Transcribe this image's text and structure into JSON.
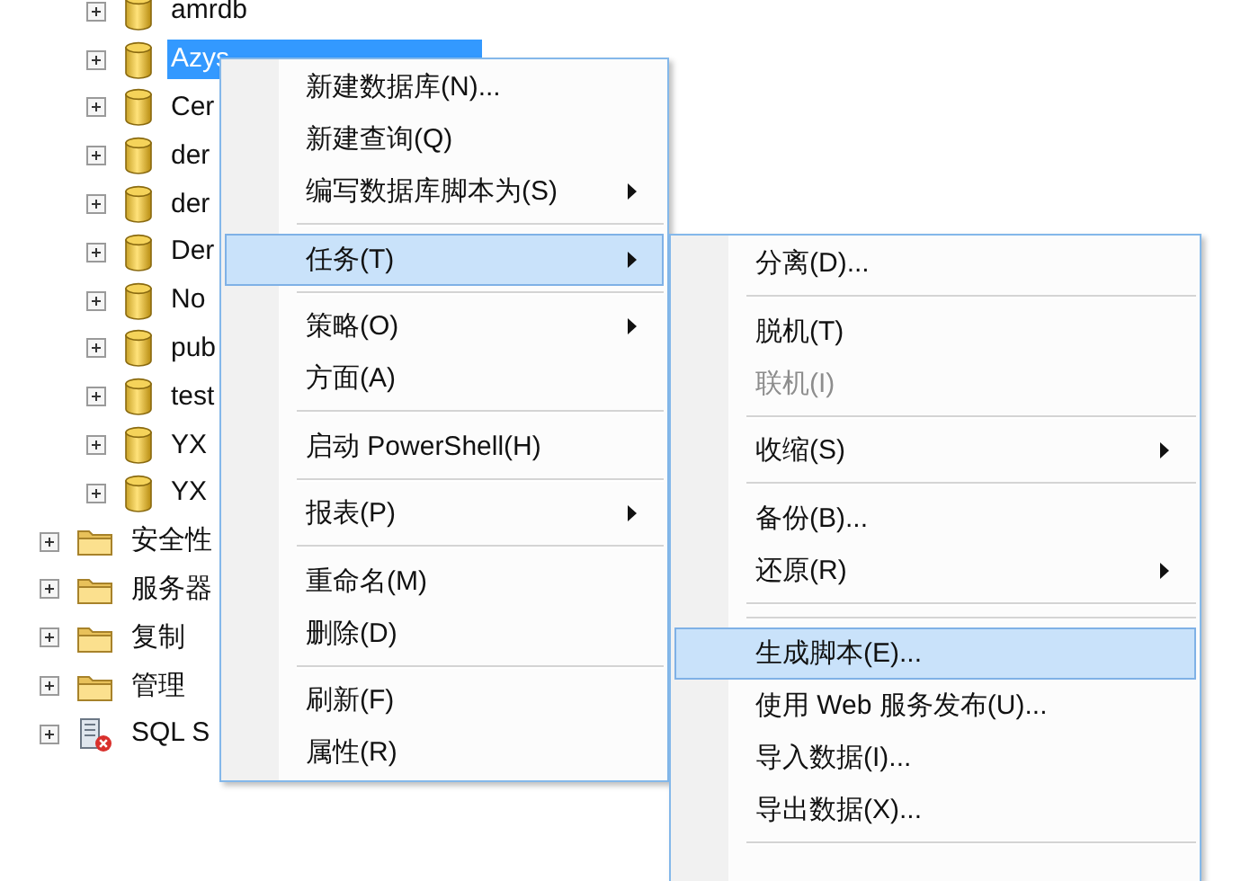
{
  "tree": {
    "databases": [
      {
        "label": "amrdb",
        "selected": false
      },
      {
        "label": "Azys",
        "selected": true
      },
      {
        "label": "Cer",
        "selected": false
      },
      {
        "label": "der",
        "selected": false
      },
      {
        "label": "der",
        "selected": false
      },
      {
        "label": "Der",
        "selected": false
      },
      {
        "label": "No",
        "selected": false
      },
      {
        "label": "pub",
        "selected": false
      },
      {
        "label": "test",
        "selected": false
      },
      {
        "label": "YX",
        "selected": false
      },
      {
        "label": "YX",
        "selected": false
      }
    ],
    "nodes": [
      {
        "label": "安全性",
        "kind": "folder"
      },
      {
        "label": "服务器",
        "kind": "folder"
      },
      {
        "label": "复制",
        "kind": "folder"
      },
      {
        "label": "管理",
        "kind": "folder"
      },
      {
        "label": "SQL S",
        "kind": "agent"
      }
    ]
  },
  "context_menu": {
    "items": [
      {
        "kind": "item",
        "label": "新建数据库(N)...",
        "submenu": false,
        "selected": false,
        "disabled": false
      },
      {
        "kind": "item",
        "label": "新建查询(Q)",
        "submenu": false,
        "selected": false,
        "disabled": false
      },
      {
        "kind": "item",
        "label": "编写数据库脚本为(S)",
        "submenu": true,
        "selected": false,
        "disabled": false
      },
      {
        "kind": "separator"
      },
      {
        "kind": "item",
        "label": "任务(T)",
        "submenu": true,
        "selected": true,
        "disabled": false
      },
      {
        "kind": "separator"
      },
      {
        "kind": "item",
        "label": "策略(O)",
        "submenu": true,
        "selected": false,
        "disabled": false
      },
      {
        "kind": "item",
        "label": "方面(A)",
        "submenu": false,
        "selected": false,
        "disabled": false
      },
      {
        "kind": "separator"
      },
      {
        "kind": "item",
        "label": "启动 PowerShell(H)",
        "submenu": false,
        "selected": false,
        "disabled": false
      },
      {
        "kind": "separator"
      },
      {
        "kind": "item",
        "label": "报表(P)",
        "submenu": true,
        "selected": false,
        "disabled": false
      },
      {
        "kind": "separator"
      },
      {
        "kind": "item",
        "label": "重命名(M)",
        "submenu": false,
        "selected": false,
        "disabled": false
      },
      {
        "kind": "item",
        "label": "删除(D)",
        "submenu": false,
        "selected": false,
        "disabled": false
      },
      {
        "kind": "separator"
      },
      {
        "kind": "item",
        "label": "刷新(F)",
        "submenu": false,
        "selected": false,
        "disabled": false
      },
      {
        "kind": "item",
        "label": "属性(R)",
        "submenu": false,
        "selected": false,
        "disabled": false
      }
    ]
  },
  "tasks_submenu": {
    "items": [
      {
        "kind": "item",
        "label": "分离(D)...",
        "submenu": false,
        "selected": false,
        "disabled": false
      },
      {
        "kind": "separator"
      },
      {
        "kind": "item",
        "label": "脱机(T)",
        "submenu": false,
        "selected": false,
        "disabled": false
      },
      {
        "kind": "item",
        "label": "联机(I)",
        "submenu": false,
        "selected": false,
        "disabled": true
      },
      {
        "kind": "separator"
      },
      {
        "kind": "item",
        "label": "收缩(S)",
        "submenu": true,
        "selected": false,
        "disabled": false
      },
      {
        "kind": "separator"
      },
      {
        "kind": "item",
        "label": "备份(B)...",
        "submenu": false,
        "selected": false,
        "disabled": false
      },
      {
        "kind": "item",
        "label": "还原(R)",
        "submenu": true,
        "selected": false,
        "disabled": false
      },
      {
        "kind": "separator"
      },
      {
        "kind": "separator"
      },
      {
        "kind": "item",
        "label": "生成脚本(E)...",
        "submenu": false,
        "selected": true,
        "disabled": false
      },
      {
        "kind": "item",
        "label": "使用 Web 服务发布(U)...",
        "submenu": false,
        "selected": false,
        "disabled": false
      },
      {
        "kind": "item",
        "label": "导入数据(I)...",
        "submenu": false,
        "selected": false,
        "disabled": false
      },
      {
        "kind": "item",
        "label": "导出数据(X)...",
        "submenu": false,
        "selected": false,
        "disabled": false
      },
      {
        "kind": "separator"
      }
    ]
  }
}
